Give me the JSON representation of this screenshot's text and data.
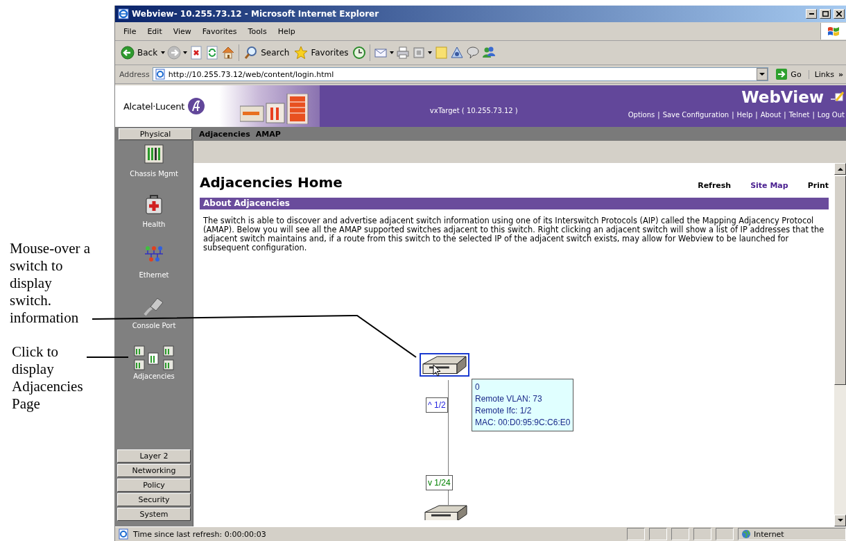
{
  "annotations": [
    {
      "text": "Mouse-over a switch to display switch. information"
    },
    {
      "text": "Click to display Adjacencies Page"
    }
  ],
  "window": {
    "title": "Webview- 10.255.73.12 - Microsoft Internet Explorer"
  },
  "menu": [
    "File",
    "Edit",
    "View",
    "Favorites",
    "Tools",
    "Help"
  ],
  "toolbar": [
    {
      "kind": "back",
      "label": "Back",
      "dropdown": true
    },
    {
      "kind": "forward",
      "dropdown": true
    },
    {
      "kind": "stop",
      "dropdown": false
    },
    {
      "kind": "refresh",
      "dropdown": false
    },
    {
      "kind": "home",
      "dropdown": false
    },
    {
      "kind": "search",
      "label": "Search",
      "dropdown": false
    },
    {
      "kind": "favorites",
      "label": "Favorites",
      "dropdown": false
    },
    {
      "kind": "history",
      "dropdown": false
    },
    {
      "kind": "mail",
      "dropdown": true
    },
    {
      "kind": "print",
      "dropdown": false
    },
    {
      "kind": "window",
      "dropdown": true
    },
    {
      "kind": "note",
      "dropdown": false
    },
    {
      "kind": "tool",
      "dropdown": false
    },
    {
      "kind": "chat",
      "dropdown": false
    },
    {
      "kind": "people",
      "dropdown": false
    }
  ],
  "address": {
    "label": "Address",
    "value": "http://10.255.73.12/web/content/login.html",
    "go": "Go",
    "links": "Links",
    "more": "»"
  },
  "header": {
    "brand": "Alcatel·Lucent",
    "target": "vxTarget ( 10.255.73.12 )",
    "product": "WebView",
    "separator": "|",
    "links": [
      "Options",
      "Save Configuration",
      "Help",
      "About",
      "Telnet",
      "Log Out"
    ]
  },
  "nav": {
    "category": "Physical",
    "breadcrumbs": [
      "Adjacencies",
      "AMAP"
    ]
  },
  "sidebar": {
    "items": [
      {
        "kind": "chassis",
        "label": "Chassis Mgmt"
      },
      {
        "kind": "health",
        "label": "Health"
      },
      {
        "kind": "ethernet",
        "label": "Ethernet"
      },
      {
        "kind": "console",
        "label": "Console Port"
      },
      {
        "kind": "adjacencies",
        "label": "Adjacencies"
      }
    ],
    "categories": [
      "Layer 2",
      "Networking",
      "Policy",
      "Security",
      "System"
    ]
  },
  "page": {
    "title": "Adjacencies Home",
    "actions": [
      {
        "label": "Refresh",
        "visited": false
      },
      {
        "label": "Site Map",
        "visited": true
      },
      {
        "label": "Print",
        "visited": false
      }
    ],
    "section": "About Adjacencies",
    "description": "The switch is able to discover and advertise adjacent switch information using one of its Interswitch Protocols (AIP) called the Mapping Adjacency Protocol (AMAP). Below you will see all the AMAP supported switches adjacent to this switch. Right clicking an adjacent switch will show a list of IP addresses that the adjacent switch maintains and, if a route from this switch to the selected IP of the adjacent switch exists, may allow for Webview to be launched for subsequent configuration."
  },
  "diagram": {
    "switches": [
      {
        "selected": true
      },
      {
        "selected": false
      }
    ],
    "links": [
      {
        "label": "^ 1/2",
        "color": "#2424e0"
      },
      {
        "label": "v 1/24",
        "color": "#008000"
      }
    ],
    "tooltip": [
      "0",
      "Remote VLAN: 73",
      "Remote Ifc: 1/2",
      "MAC: 00:D0:95:9C:C6:E0"
    ]
  },
  "status_bar": {
    "text": "Time since last refresh: 0:00:00:03",
    "zone": "Internet"
  }
}
